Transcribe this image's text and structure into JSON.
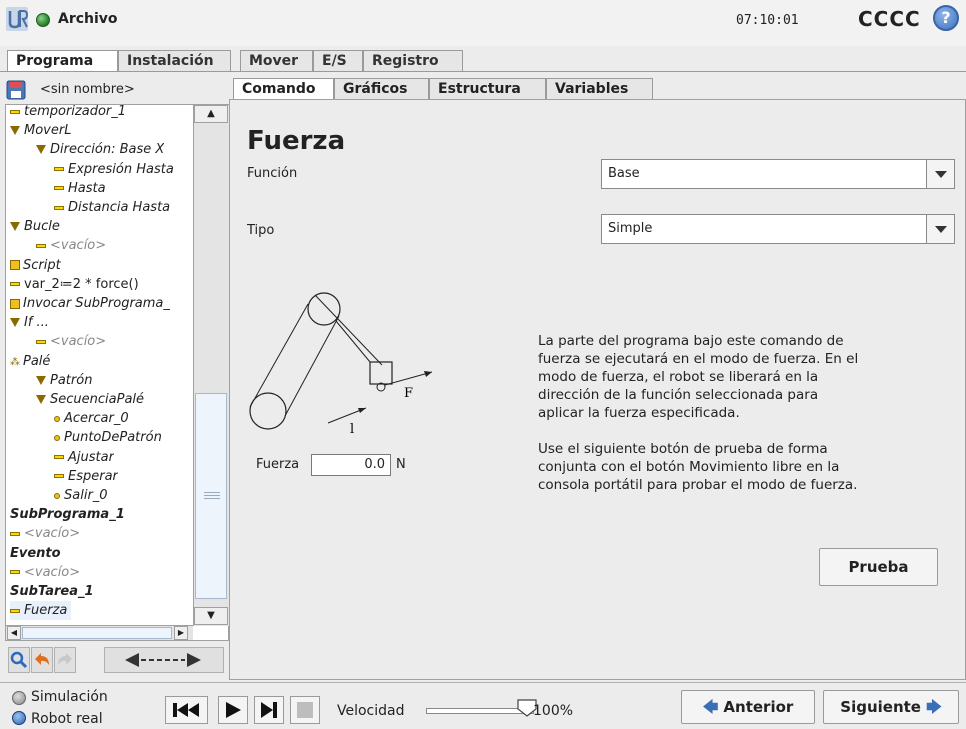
{
  "header": {
    "title": "Archivo",
    "time": "07:10:01",
    "robot_name": "CCCC",
    "help_icon": "question-mark-icon",
    "status_color": "#2f8a2f"
  },
  "main_tabs": [
    "Programa",
    "Instalación",
    "Mover",
    "E/S",
    "Registro"
  ],
  "program": {
    "name": "<sin nombre>",
    "tree": [
      {
        "label": "temporizador_1",
        "icon": "bar",
        "indent": 0
      },
      {
        "label": "MoverL",
        "icon": "tri",
        "indent": 0
      },
      {
        "label": "Dirección: Base X",
        "icon": "tri",
        "indent": 1
      },
      {
        "label": "Expresión Hasta",
        "icon": "bar",
        "indent": 2
      },
      {
        "label": "Hasta",
        "icon": "bar",
        "indent": 2
      },
      {
        "label": "Distancia Hasta",
        "icon": "bar",
        "indent": 2
      },
      {
        "label": "Bucle",
        "icon": "tri",
        "indent": 0
      },
      {
        "label": "<vacío>",
        "icon": "bar",
        "indent": 1,
        "grey": true
      },
      {
        "label": "Script",
        "icon": "sq",
        "indent": 0
      },
      {
        "label": "var_2≔2 * force()",
        "icon": "bar",
        "indent": 0,
        "normal": true
      },
      {
        "label": "Invocar SubPrograma_",
        "icon": "sq",
        "indent": 0
      },
      {
        "label": "If ...",
        "icon": "tri",
        "indent": 0
      },
      {
        "label": "<vacío>",
        "icon": "bar",
        "indent": 1,
        "grey": true
      },
      {
        "label": "Palé",
        "icon": "dots",
        "indent": 0
      },
      {
        "label": "Patrón",
        "icon": "tri",
        "indent": 1
      },
      {
        "label": "SecuenciaPalé",
        "icon": "tri",
        "indent": 1
      },
      {
        "label": "Acercar_0",
        "icon": "dot",
        "indent": 2
      },
      {
        "label": "PuntoDePatrón",
        "icon": "dot",
        "indent": 2
      },
      {
        "label": "Ajustar",
        "icon": "bar",
        "indent": 2
      },
      {
        "label": "Esperar",
        "icon": "bar",
        "indent": 2
      },
      {
        "label": "Salir_0",
        "icon": "dot",
        "indent": 2
      },
      {
        "label": "SubPrograma_1",
        "icon": "none",
        "indent": 0,
        "bold": true
      },
      {
        "label": "<vacío>",
        "icon": "bar",
        "indent": 0,
        "grey": true
      },
      {
        "label": "Evento",
        "icon": "none",
        "indent": 0,
        "bold": true
      },
      {
        "label": "<vacío>",
        "icon": "bar",
        "indent": 0,
        "grey": true
      },
      {
        "label": "SubTarea_1",
        "icon": "none",
        "indent": 0,
        "bold": true
      },
      {
        "label": "Fuerza",
        "icon": "bar",
        "indent": 0,
        "selected": true
      }
    ]
  },
  "sub_tabs": [
    "Comando",
    "Gráficos",
    "Estructura",
    "Variables"
  ],
  "command": {
    "title": "Fuerza",
    "funcion_label": "Función",
    "funcion_value": "Base",
    "tipo_label": "Tipo",
    "tipo_value": "Simple",
    "diagram_f": "F",
    "diagram_l": "l",
    "description": "La parte del programa bajo este comando de\nfuerza se ejecutará en el modo de fuerza. En el\nmodo de fuerza, el robot se liberará en la\ndirección de la función seleccionada para\naplicar la fuerza especificada.\n\nUse el siguiente botón de prueba de forma\nconjunta con el botón Movimiento libre en la\nconsola portátil para probar el modo de fuerza.",
    "force_label": "Fuerza",
    "force_value": "0.0",
    "force_unit": "N",
    "test_button": "Prueba"
  },
  "footer": {
    "simulation": "Simulación",
    "real_robot": "Robot real",
    "speed_label": "Velocidad",
    "speed_value": "100%",
    "speed_fraction": 1.0,
    "prev": "Anterior",
    "next": "Siguiente"
  }
}
